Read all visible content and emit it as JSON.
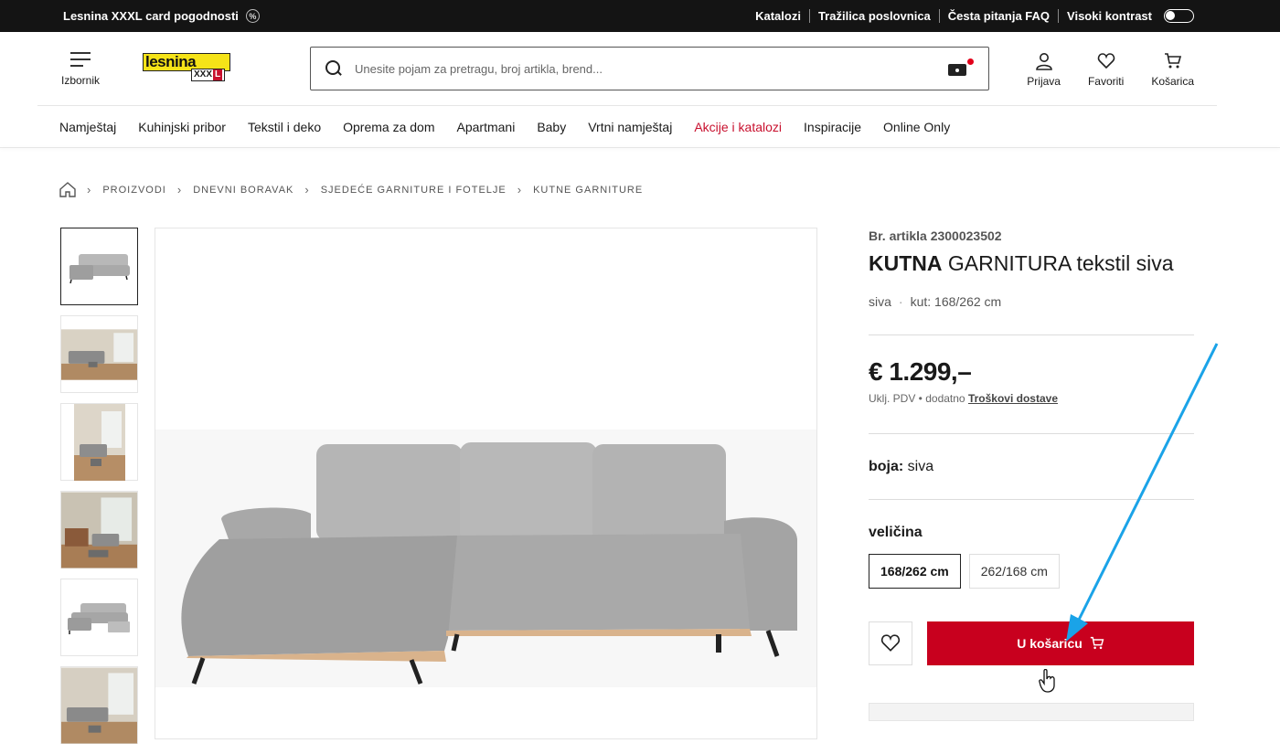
{
  "topbar": {
    "promo_label": "Lesnina XXXL card pogodnosti",
    "promo_icon": "percent-icon",
    "links": [
      "Katalozi",
      "Tražilica poslovnica",
      "Česta pitanja FAQ",
      "Visoki kontrast"
    ],
    "contrast_toggle": "off"
  },
  "header": {
    "menu_label": "Izbornik",
    "logo_text": "lesnina",
    "logo_sub": "XXX",
    "logo_sub_accent": "L",
    "search_placeholder": "Unesite pojam za pretragu, broj artikla, brend...",
    "search_value": "",
    "login_label": "Prijava",
    "favorites_label": "Favoriti",
    "cart_label": "Košarica",
    "brand_yellow": "#f5e318",
    "brand_red": "#c8102e"
  },
  "nav": {
    "items": [
      "Namještaj",
      "Kuhinjski pribor",
      "Tekstil i deko",
      "Oprema za dom",
      "Apartmani",
      "Baby",
      "Vrtni namještaj",
      "Akcije i katalozi",
      "Inspiracije",
      "Online Only"
    ],
    "promo_color": "#c8102e"
  },
  "breadcrumb": [
    "PROIZVODI",
    "DNEVNI BORAVAK",
    "SJEDEĆE GARNITURE I FOTELJE",
    "KUTNE GARNITURE"
  ],
  "product": {
    "article_no": "Br. artikla 2300023502",
    "title_bold": "KUTNA",
    "title_rest": " GARNITURA tekstil siva",
    "color_meta": "siva",
    "size_meta": "kut: 168/262 cm",
    "price": "€ 1.299,–",
    "vat": "Uklj. PDV",
    "vat_extra": "dodatno",
    "shipping_link": "Troškovi dostave",
    "color_label": "boja:",
    "color_value": "siva",
    "size_label": "veličina",
    "sizes": [
      "168/262 cm",
      "262/168 cm"
    ],
    "selected_size": "168/262 cm",
    "add_to_cart": "U košaricu",
    "cart_button_color": "#c8001e"
  },
  "gallery": {
    "thumbnail_count": 6,
    "active_index": 0
  },
  "annotation": {
    "arrow_color": "#1aa3e8"
  }
}
